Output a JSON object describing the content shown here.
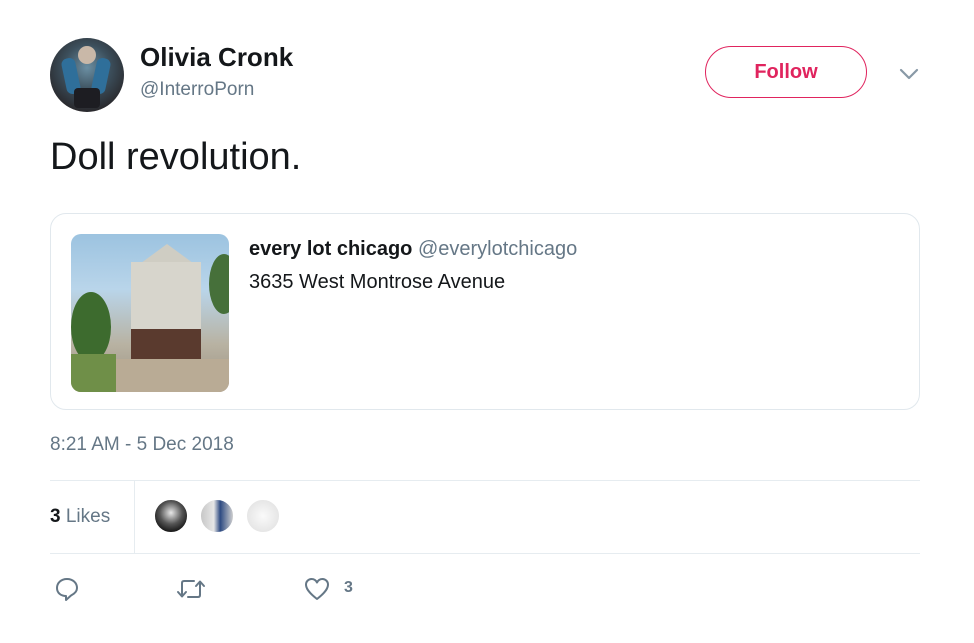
{
  "author": {
    "name": "Olivia Cronk",
    "handle": "@InterroPorn"
  },
  "follow_label": "Follow",
  "tweet": {
    "text": "Doll revolution.",
    "timestamp": "8:21 AM - 5 Dec 2018"
  },
  "quoted": {
    "name": "every lot chicago",
    "handle": "@everylotchicago",
    "text": "3635 West Montrose Avenue"
  },
  "stats": {
    "likes_count": "3",
    "likes_label": "Likes"
  },
  "actions": {
    "like_count": "3"
  },
  "colors": {
    "accent": "#e0245e",
    "muted": "#657786",
    "text": "#14171a",
    "border": "#e1e8ed"
  },
  "icons": [
    "chevron-down-icon",
    "reply-icon",
    "retweet-icon",
    "heart-icon"
  ]
}
